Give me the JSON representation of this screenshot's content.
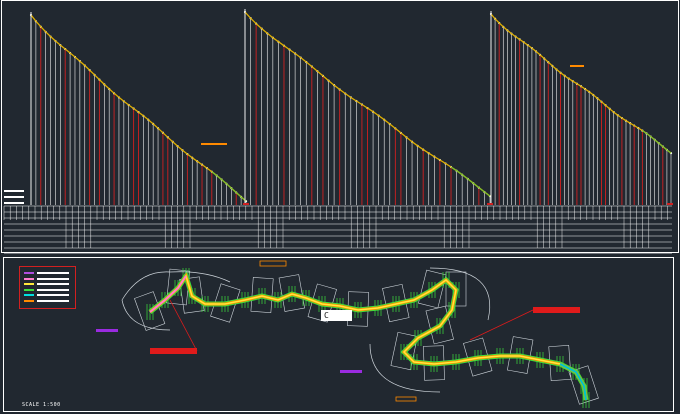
{
  "drawing": {
    "scale_label": "SCALE 1:500",
    "plan_callout_text": "C",
    "background": "#212830",
    "colors": {
      "frame": "#ffffff",
      "profile_line": "#e0b000",
      "profile_line_end": "#7fbf2a",
      "red_station": "#d02020",
      "white_station": "#f0f0f0",
      "road_center": "#ffeb3b",
      "road_edge_green": "#3ce03c",
      "road_edge_pink": "#ff7fd0",
      "road_edge_orange": "#ff8a00",
      "leader_red": "#e01b1b",
      "leader_purple": "#9a2be0",
      "legend_border": "#d32020"
    },
    "legend": [
      {
        "color": "#b04ee0",
        "icon": "purple-line-icon"
      },
      {
        "color": "#ff7fd0",
        "icon": "pink-line-icon"
      },
      {
        "color": "#ffeb3b",
        "icon": "yellow-line-icon"
      },
      {
        "color": "#3ce03c",
        "icon": "green-line-icon"
      },
      {
        "color": "#00e0e0",
        "icon": "cyan-line-icon"
      },
      {
        "color": "#ff8a00",
        "icon": "orange-line-icon"
      }
    ]
  }
}
